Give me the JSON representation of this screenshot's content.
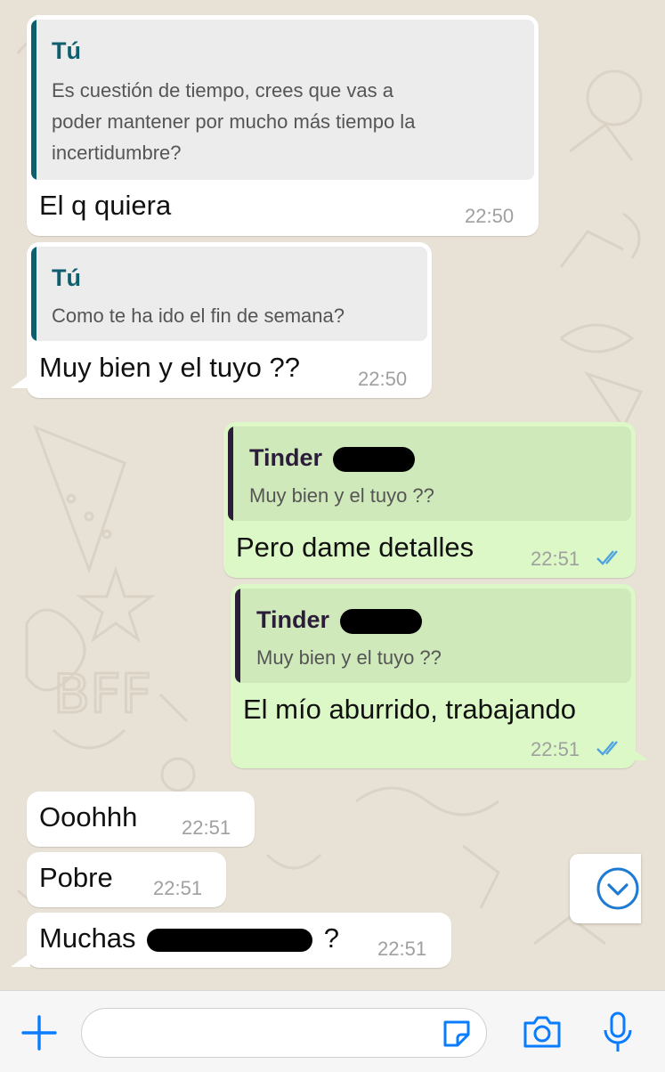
{
  "messages": [
    {
      "quote_author": "Tú",
      "quote_lines": [
        "Es cuestión de tiempo, crees que vas a",
        "poder mantener por mucho más tiempo la",
        "incertidumbre?"
      ],
      "text": "El q quiera",
      "time": "22:50"
    },
    {
      "quote_author": "Tú",
      "quote_lines": [
        "Como te ha ido el fin de semana?"
      ],
      "text": "Muy bien y el tuyo ??",
      "time": "22:50"
    },
    {
      "quote_author": "Tinder",
      "quote_lines": [
        "Muy bien y el tuyo ??"
      ],
      "text": "Pero dame detalles",
      "time": "22:51"
    },
    {
      "quote_author": "Tinder",
      "quote_lines": [
        "Muy bien y el tuyo ??"
      ],
      "text": "El mío aburrido, trabajando",
      "time": "22:51"
    },
    {
      "text": "Ooohhh",
      "time": "22:51"
    },
    {
      "text": "Pobre",
      "time": "22:51"
    },
    {
      "text_before": "Muchas",
      "text_after": "?",
      "time": "22:51"
    }
  ],
  "colors": {
    "incoming_bubble": "#ffffff",
    "outgoing_bubble": "#dcf8c6",
    "self_quote_accent": "#0e5f6e",
    "contact_quote_accent": "#2b1d3a",
    "read_ticks": "#4fa3e0",
    "toolbar_icons": "#0a7cff"
  },
  "icons": [
    "double-check-icon",
    "chevron-down-icon",
    "plus-icon",
    "sticker-icon",
    "camera-icon",
    "microphone-icon"
  ]
}
